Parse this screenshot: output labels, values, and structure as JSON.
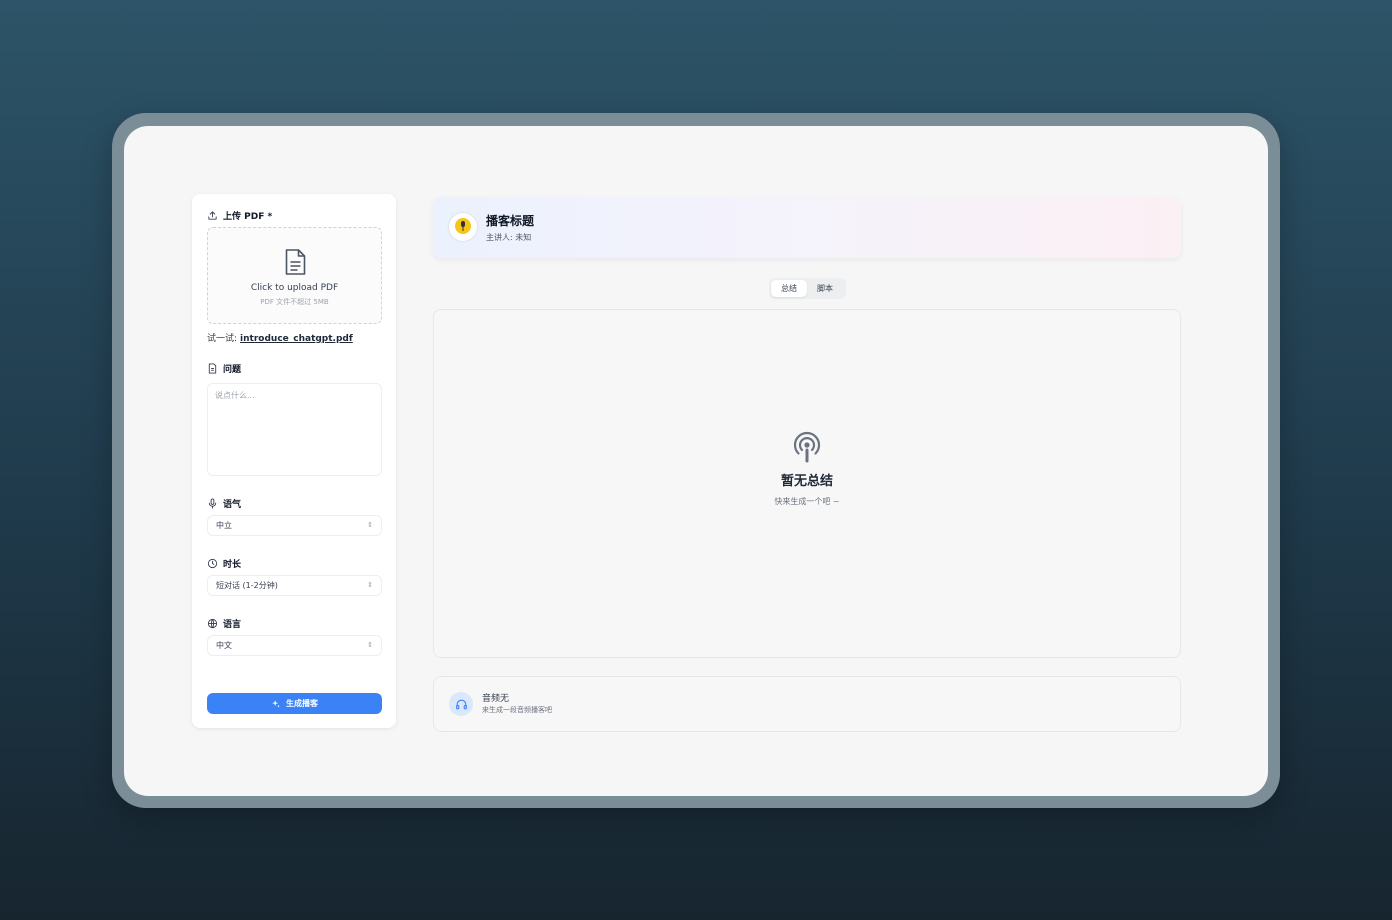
{
  "upload": {
    "label": "上传 PDF *",
    "title": "Click to upload PDF",
    "hint": "PDF 文件不超过 5MB",
    "try_prefix": "试一试:",
    "try_file": "introduce_chatgpt.pdf"
  },
  "question": {
    "label": "问题",
    "placeholder": "说点什么..."
  },
  "tone": {
    "label": "语气",
    "value": "中立"
  },
  "duration": {
    "label": "时长",
    "value": "短对话 (1-2分钟)"
  },
  "language": {
    "label": "语言",
    "value": "中文"
  },
  "generate_button": "生成播客",
  "podcast": {
    "title": "播客标题",
    "host": "主讲人: 未知"
  },
  "tabs": [
    {
      "label": "总结",
      "active": true
    },
    {
      "label": "脚本",
      "active": false
    }
  ],
  "summary": {
    "empty_title": "暂无总结",
    "empty_hint": "快来生成一个吧 ~"
  },
  "audio": {
    "title": "音频无",
    "subtitle": "来生成一段音频播客吧"
  },
  "colors": {
    "accent": "#3b82f6",
    "avatar": "#f5c518"
  },
  "icons": [
    "upload-icon",
    "file-icon",
    "document-icon",
    "microphone-icon",
    "clock-icon",
    "globe-icon",
    "sparkle-icon",
    "podcast-icon",
    "headphones-icon"
  ]
}
